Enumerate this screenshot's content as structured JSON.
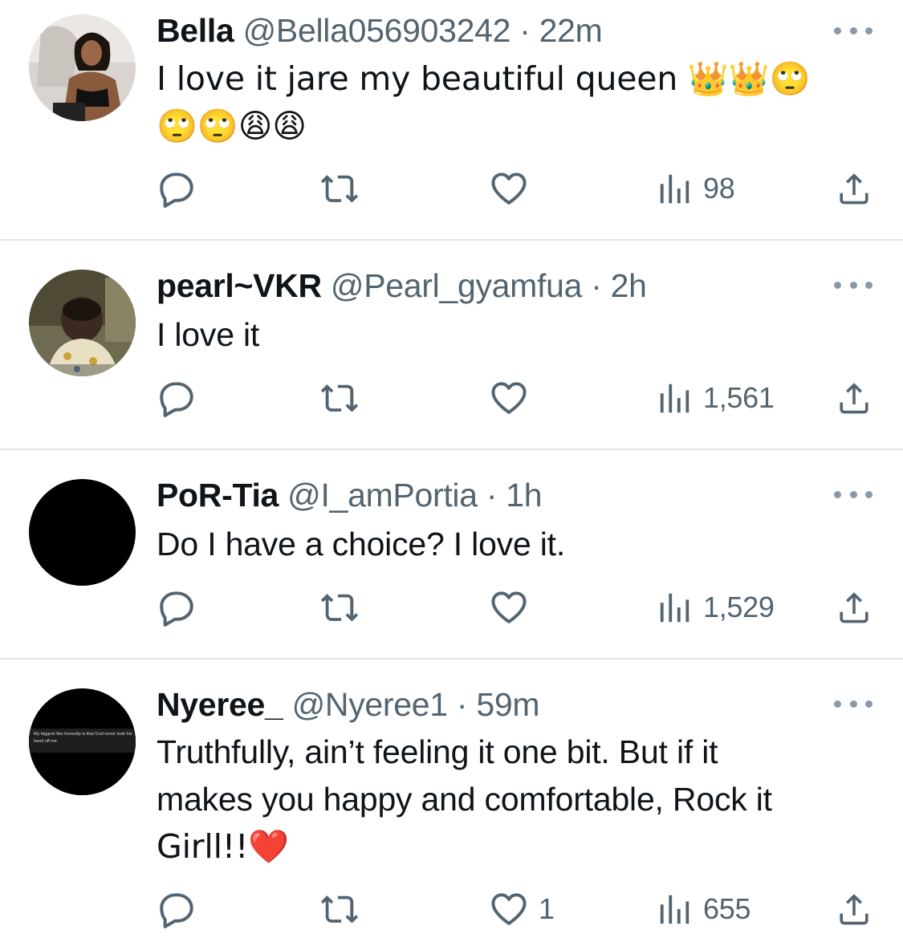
{
  "colors": {
    "text": "#0f1419",
    "secondary": "#536471",
    "divider": "#e1e6ea",
    "icon": "#536471"
  },
  "replies": [
    {
      "name": "Bella",
      "handle": "@Bella056903242",
      "separator": "·",
      "time": "22m",
      "text_line1": "I love it jare my beautiful queen 👑👑🙄",
      "text_line2": "🙄🙄😩😩",
      "reply_count": "",
      "retweet_count": "",
      "like_count": "",
      "views": "98",
      "avatar_icon": "photo-avatar-icon"
    },
    {
      "name": "pearl~VKR",
      "handle": "@Pearl_gyamfua",
      "separator": "·",
      "time": "2h",
      "text_line1": "I love it",
      "reply_count": "",
      "retweet_count": "",
      "like_count": "",
      "views": "1,561",
      "avatar_icon": "photo-avatar-icon"
    },
    {
      "name": "PoR-Tia",
      "handle": "@I_amPortia",
      "separator": "·",
      "time": "1h",
      "text_line1": "Do I have a choice? I love it.",
      "reply_count": "",
      "retweet_count": "",
      "like_count": "",
      "views": "1,529",
      "avatar_icon": "black-avatar-icon"
    },
    {
      "name": "Nyeree_",
      "handle": "@Nyeree1",
      "separator": "·",
      "time": "59m",
      "text_line1": "Truthfully, ain’t feeling it one bit. But if it",
      "text_line2": "makes you happy and comfortable, Rock it",
      "text_line3": "Girll!!❤️",
      "avatar_caption": "My biggest flex honestly is that God never took his hand off me",
      "reply_count": "",
      "retweet_count": "",
      "like_count": "1",
      "views": "655",
      "avatar_icon": "text-avatar-icon"
    }
  ]
}
